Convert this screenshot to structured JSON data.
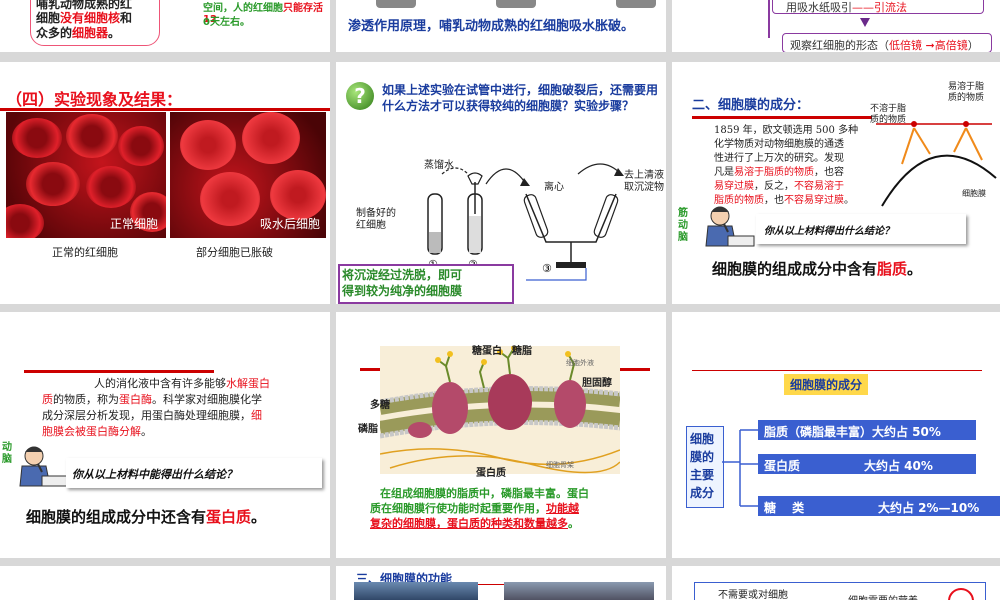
{
  "s1": {
    "line1": "哺乳动物成熟的红",
    "line2a": "细胞",
    "line2b": "没有细胞核",
    "line2c": "和",
    "line3a": "众多的",
    "line3b": "细胞器",
    "line3c": "。"
  },
  "s2": {
    "line1": "空间，人的红细胞",
    "line1b": "只能存活12",
    "line2": "0天左右。"
  },
  "s3": {
    "caption": "渗透作用原理，哺乳动物成熟的红细胞吸水胀破。"
  },
  "s4": {
    "line1a": "用吸水纸吸引",
    "line1b": "——引流法",
    "line2a": "观察红细胞的形态（",
    "line2b": "低倍镜",
    "line2c": " ➞高倍镜",
    "line2d": "）"
  },
  "s5": {
    "title": "（四）实验现象及结果：",
    "label_normal": "正常细胞",
    "label_swell": "吸水后细胞",
    "cap_normal": "正常的红细胞",
    "cap_swell": "部分细胞已胀破"
  },
  "s6": {
    "question": "如果上述实验在试管中进行，细胞破裂后，还需要用什么方法才可以获得较纯的细胞膜？实验步骤？",
    "label_water": "蒸馏水",
    "label_rbc1": "制备好的",
    "label_rbc2": "红细胞",
    "label_centrifuge": "离心",
    "label_sup1": "去上清液",
    "label_sup2": "取沉淀物",
    "n1": "①",
    "n2": "②",
    "n3": "③",
    "answer1": "将沉淀经过洗脱，即可",
    "answer2": "得到较为纯净的细胞膜"
  },
  "s7": {
    "title": "二、细胞膜的成分：",
    "text1": "1859 年，欧文顿选用 500 多种",
    "text2": "化学物质对动物细胞膜的通透",
    "text3": "性进行了上万次的研究。发现",
    "text4a": "凡是",
    "text4b": "易溶于脂质的物质",
    "text4c": "，也容",
    "text5a": "易穿过膜",
    "text5b": "，反之，",
    "text5c": "不容易溶于",
    "text6a": "脂质的物质",
    "text6b": "，也",
    "text6c": "不容易穿过膜",
    "text6d": "。",
    "lab_insol1": "不溶于脂",
    "lab_insol2": "质的物质",
    "lab_sol1": "易溶于脂",
    "lab_sol2": "质的物质",
    "lab_membrane": "细胞膜",
    "brain1": "筋",
    "brain2": "动",
    "brain3": "脑",
    "question": "你从以上材料得出什么结论？",
    "conclusion_a": "细胞膜的组成成分中含有",
    "conclusion_b": "脂质",
    "conclusion_c": "。"
  },
  "s8": {
    "text1": "人的消化液中含有许多能够",
    "text1b": "水解蛋白",
    "text2a": "质",
    "text2b": "的物质，称为",
    "text2c": "蛋白酶",
    "text2d": "。科学家对细胞膜化学",
    "text3a": "成分深层分析发现，用蛋白酶处理细胞膜，",
    "text3b": "细",
    "text4": "胞膜会被蛋白酶分解",
    "text4b": "。",
    "brain1": "动",
    "brain2": "脑",
    "question": "你从以上材料中能得出什么结论？",
    "conclusion_a": "细胞膜的组成成分中还含有",
    "conclusion_b": "蛋白质",
    "conclusion_c": "。"
  },
  "s9": {
    "lab_glycoprotein": "糖蛋白",
    "lab_glycolipid": "糖脂",
    "lab_cholesterol": "胆固醇",
    "lab_sugar": "多糖",
    "lab_phospholipid": "磷脂",
    "lab_protein": "蛋白质",
    "lab_outside": "细胞外液",
    "lab_inside": "细胞骨架",
    "caption1": "在组成细胞膜的脂质中，磷脂最丰富。蛋白",
    "caption2a": "质在细胞膜行使功能时起重要作用，",
    "caption2b": "功能越",
    "caption3": "复杂的细胞膜，蛋白质的种类和数量越多",
    "caption3b": "。"
  },
  "s10": {
    "title": "细胞膜的成分",
    "main1": "细胞",
    "main2": "膜的",
    "main3": "主要",
    "main4": "成分",
    "item1": "脂质（磷脂最丰富）大约占 50%",
    "item2a": "蛋白质",
    "item2b": "大约占 40%",
    "item3a": "糖　 类",
    "item3b": "大约占 2%—10%"
  },
  "s11": {
    "title": "三、细胞膜的功能"
  },
  "s12": {
    "line1": "不需要或对细胞",
    "line2": "细胞需要的营养"
  },
  "colors": {
    "accent_red": "#e8101c",
    "title_blue": "#1a3c9e",
    "box_blue": "#3a5fd0",
    "box_fill": "#eef4ff",
    "highlight_yellow": "#ffd84a"
  }
}
